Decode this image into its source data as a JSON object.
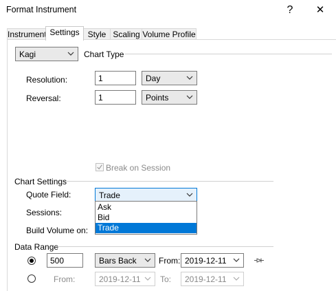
{
  "window": {
    "title": "Format Instrument",
    "help_glyph": "?",
    "close_glyph": "✕"
  },
  "tabs": [
    {
      "label": "Instrument"
    },
    {
      "label": "Settings"
    },
    {
      "label": "Style"
    },
    {
      "label": "Scaling"
    },
    {
      "label": "Volume Profile"
    }
  ],
  "active_tab": "Settings",
  "chart_type": {
    "value": "Kagi",
    "label": "Chart Type"
  },
  "resolution": {
    "label": "Resolution:",
    "value": "1",
    "unit": "Day"
  },
  "reversal": {
    "label": "Reversal:",
    "value": "1",
    "unit": "Points"
  },
  "break_on_session": {
    "label": "Break on Session",
    "checked": true,
    "enabled": false
  },
  "chart_settings": {
    "label": "Chart Settings",
    "quote_field_label": "Quote Field:",
    "quote_field_value": "Trade",
    "sessions_label": "Sessions:",
    "build_volume_label": "Build Volume on:",
    "dropdown_options": [
      "Ask",
      "Bid",
      "Trade"
    ],
    "selected_option": "Trade"
  },
  "data_range": {
    "label": "Data Range",
    "bars_value": "500",
    "bars_mode": "Bars Back",
    "from_label": "From:",
    "from_date": "2019-12-11",
    "row2_from_label": "From:",
    "row2_from_date": "2019-12-11",
    "to_label": "To:",
    "to_date": "2019-12-11"
  },
  "colors": {
    "selection": "#0078d7",
    "combo_bg": "#e9e9e9"
  }
}
